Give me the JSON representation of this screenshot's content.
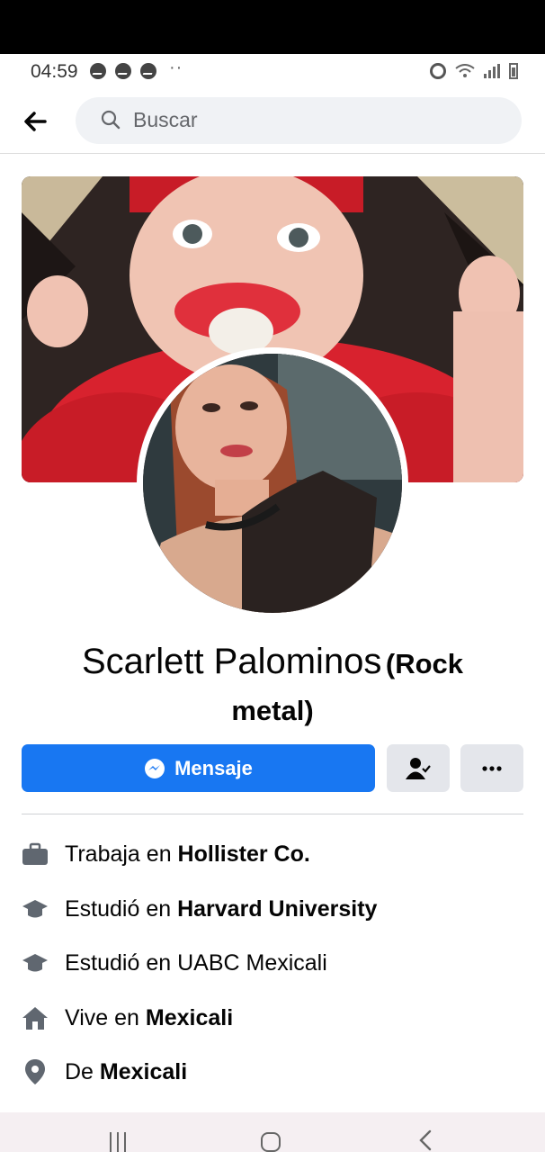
{
  "status_bar": {
    "time": "04:59",
    "dots": "··",
    "icons": [
      "messenger-icon",
      "messenger-icon",
      "messenger-icon",
      "alarm-icon",
      "wifi-icon",
      "signal-icon",
      "battery-icon"
    ]
  },
  "topnav": {
    "search_placeholder": "Buscar"
  },
  "profile": {
    "name": "Scarlett Palominos",
    "nickname_line1": "(Rock",
    "nickname_line2": "metal)"
  },
  "actions": {
    "message_label": "Mensaje",
    "accent_color": "#1877f2"
  },
  "intro": [
    {
      "prefix": "Trabaja en ",
      "bold": "Hollister Co.",
      "icon": "briefcase-icon"
    },
    {
      "prefix": "Estudió en ",
      "bold": "Harvard University",
      "icon": "graduation-cap-icon"
    },
    {
      "prefix": "Estudió en UABC Mexicali",
      "bold": "",
      "icon": "graduation-cap-icon"
    },
    {
      "prefix": "Vive en ",
      "bold": "Mexicali",
      "icon": "home-icon"
    },
    {
      "prefix": "De ",
      "bold": "Mexicali",
      "icon": "location-pin-icon"
    }
  ]
}
